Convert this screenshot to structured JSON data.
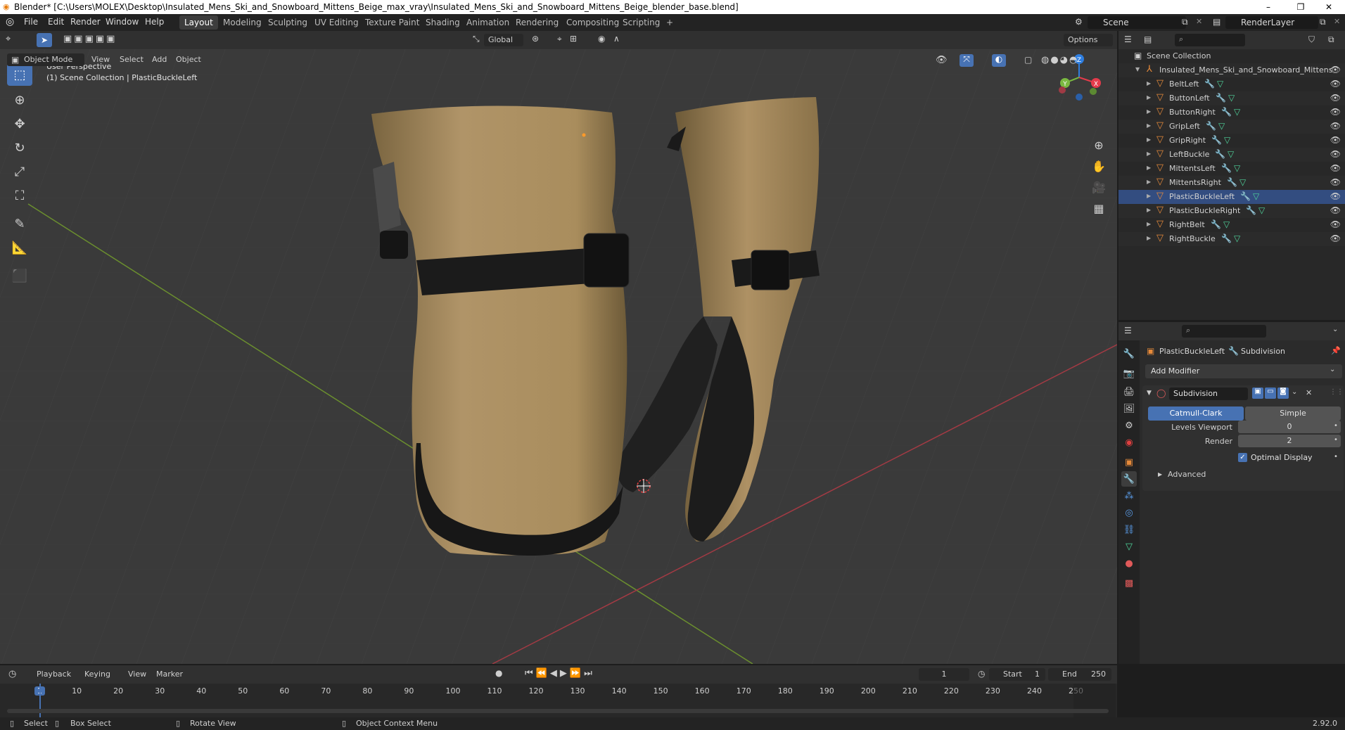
{
  "window": {
    "title": "Blender* [C:\\Users\\MOLEX\\Desktop\\Insulated_Mens_Ski_and_Snowboard_Mittens_Beige_max_vray\\Insulated_Mens_Ski_and_Snowboard_Mittens_Beige_blender_base.blend]",
    "minimize": "–",
    "restore": "❐",
    "close": "✕"
  },
  "menubar": {
    "items": [
      "File",
      "Edit",
      "Render",
      "Window",
      "Help"
    ],
    "workspaces": [
      "Layout",
      "Modeling",
      "Sculpting",
      "UV Editing",
      "Texture Paint",
      "Shading",
      "Animation",
      "Rendering",
      "Compositing",
      "Scripting"
    ],
    "add_workspace": "+",
    "scene": "Scene",
    "view_layer": "RenderLayer"
  },
  "viewport_header": {
    "mode": "Object Mode",
    "menus": [
      "View",
      "Select",
      "Add",
      "Object"
    ],
    "transform_orientation": "Global",
    "options": "Options"
  },
  "viewport": {
    "perspective": "User Perspective",
    "collection_info": "(1) Scene Collection | PlasticBuckleLeft",
    "axis_x": "X",
    "axis_y": "Y",
    "axis_z": "Z"
  },
  "outliner": {
    "root": "Scene Collection",
    "collection": "Insulated_Mens_Ski_and_Snowboard_Mittens",
    "objects": [
      "BeltLeft",
      "ButtonLeft",
      "ButtonRight",
      "GripLeft",
      "GripRight",
      "LeftBuckle",
      "MittentsLeft",
      "MittentsRight",
      "PlasticBuckleLeft",
      "PlasticBuckleRight",
      "RightBelt",
      "RightBuckle"
    ],
    "selected": "PlasticBuckleLeft"
  },
  "properties": {
    "object": "PlasticBuckleLeft",
    "modifier_context": "Subdivision",
    "add_modifier": "Add Modifier",
    "modifier_name": "Subdivision",
    "catmull_clark": "Catmull-Clark",
    "simple": "Simple",
    "levels_viewport_label": "Levels Viewport",
    "levels_viewport_value": "0",
    "render_label": "Render",
    "render_value": "2",
    "optimal_display": "Optimal Display",
    "advanced": "Advanced"
  },
  "timeline": {
    "menus": [
      "Playback",
      "Keying",
      "View",
      "Marker"
    ],
    "current_frame": "1",
    "start_label": "Start",
    "start_value": "1",
    "end_label": "End",
    "end_value": "250",
    "ticks": [
      "1",
      "10",
      "20",
      "30",
      "40",
      "50",
      "60",
      "70",
      "80",
      "90",
      "100",
      "110",
      "120",
      "130",
      "140",
      "150",
      "160",
      "170",
      "180",
      "190",
      "200",
      "210",
      "220",
      "230",
      "240",
      "250"
    ]
  },
  "statusbar": {
    "select": "Select",
    "box_select": "Box Select",
    "rotate_view": "Rotate View",
    "context_menu": "Object Context Menu",
    "version": "2.92.0"
  },
  "colors": {
    "accent": "#4772b3",
    "selected_row": "#334d80",
    "mesh_icon": "#e68a3a",
    "fabric": "#a88d5d",
    "axis_x": "#e53b4b",
    "axis_y": "#7ab940",
    "axis_z": "#2e7ee0"
  }
}
